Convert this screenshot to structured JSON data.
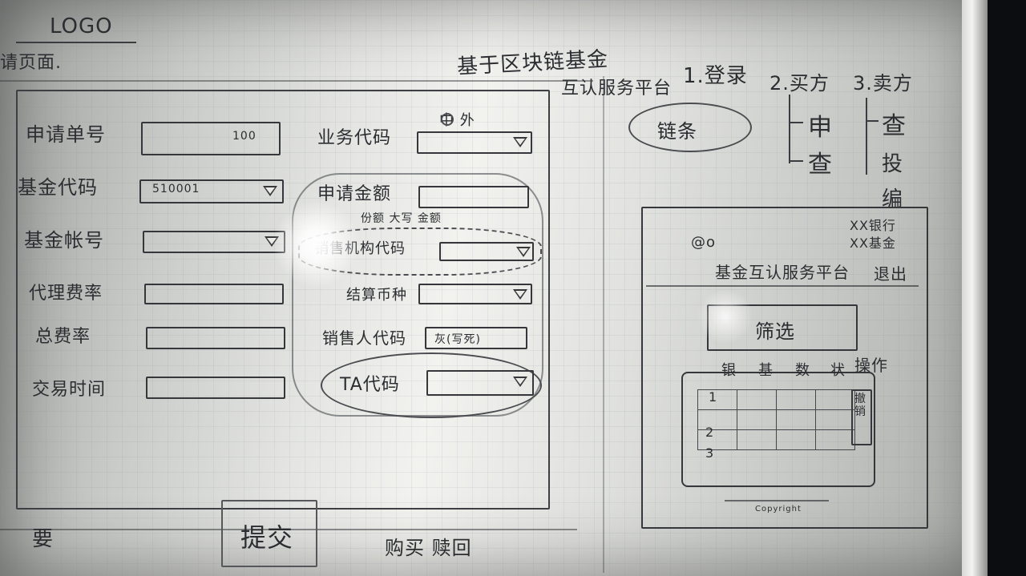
{
  "header": {
    "logo_text": "LOGO",
    "page_caption": "请页面.",
    "board_title": "基于区块链基金",
    "nav_prefix": "互认服务平台",
    "nav_items": [
      "1.登录",
      "2.买方",
      "3.卖方"
    ]
  },
  "form": {
    "left_fields": [
      {
        "label": "申请单号",
        "value": "100"
      },
      {
        "label": "基金代码",
        "value": "510001"
      },
      {
        "label": "基金帐号",
        "value": ""
      },
      {
        "label": "代理费率",
        "value": ""
      },
      {
        "label": "总费率",
        "value": ""
      },
      {
        "label": "交易时间",
        "value": ""
      }
    ],
    "radio_text": "中 外",
    "right_fields": [
      {
        "label": "业务代码",
        "value": ""
      },
      {
        "label": "申请金额",
        "value": "",
        "note": "份额 大写 金额"
      },
      {
        "label": "销售机构代码",
        "value": ""
      },
      {
        "label": "结算币种",
        "value": ""
      },
      {
        "label": "销售人代码",
        "value": "灰(写死)"
      },
      {
        "label": "TA代码",
        "value": ""
      }
    ],
    "bottom_left_text": "要",
    "submit_label": "提交",
    "bottom_text": "购买 赎回"
  },
  "right_panel": {
    "chain_button": "链条",
    "tree_left": [
      "申",
      "查"
    ],
    "tree_right": [
      "查",
      "投",
      "编"
    ],
    "preview": {
      "logo_mark": "@o",
      "platform_title": "基金互认服务平台",
      "bank_lines": [
        "XX银行",
        "XX基金"
      ],
      "exit_label": "退出",
      "search_label": "筛选",
      "table_headers": [
        "银",
        "基",
        "数",
        "状",
        "操作"
      ],
      "row_numbers": [
        "1",
        "2",
        "3"
      ],
      "row_action": "撤销",
      "footer": "Copyright"
    }
  }
}
